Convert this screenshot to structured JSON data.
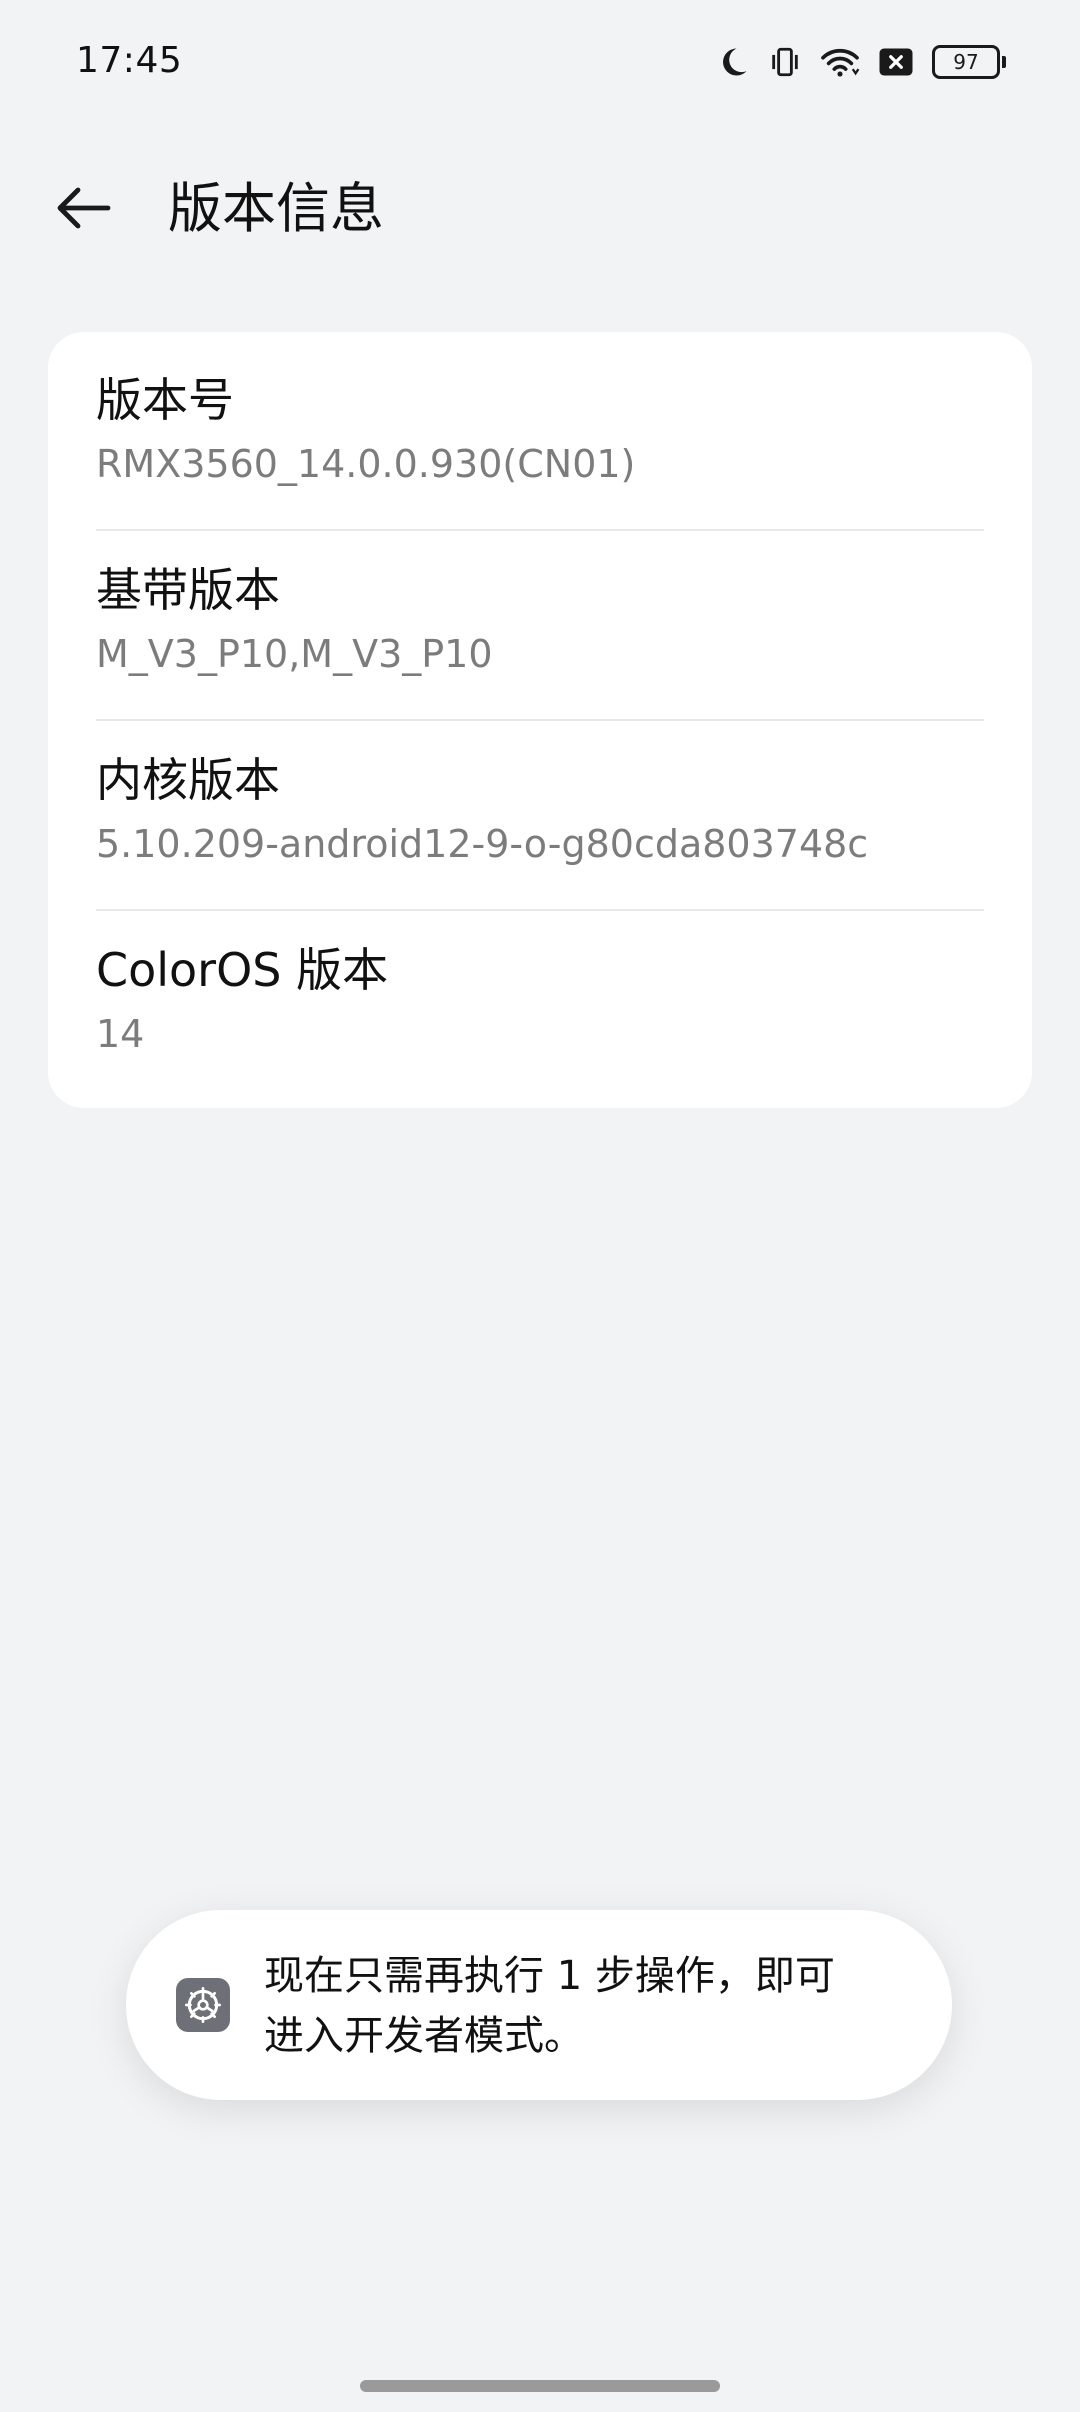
{
  "status_bar": {
    "time": "17:45",
    "battery": "97",
    "icons": [
      "moon-icon",
      "vibrate-icon",
      "wifi-icon",
      "close-box-icon",
      "battery-icon"
    ]
  },
  "header": {
    "title": "版本信息",
    "back_icon": "back-arrow-icon"
  },
  "info_rows": [
    {
      "title": "版本号",
      "value": "RMX3560_14.0.0.930(CN01)"
    },
    {
      "title": "基带版本",
      "value": "M_V3_P10,M_V3_P10"
    },
    {
      "title": "内核版本",
      "value": "5.10.209-android12-9-o-g80cda803748c"
    },
    {
      "title": "ColorOS 版本",
      "value": "14"
    }
  ],
  "toast": {
    "icon": "settings-gear-icon",
    "text_line1": "现在只需再执行 1 步操作，即可",
    "text_line2": "进入开发者模式。"
  },
  "colors": {
    "background": "#f2f3f5",
    "card": "#ffffff",
    "secondary_text": "#7c7c7c"
  }
}
